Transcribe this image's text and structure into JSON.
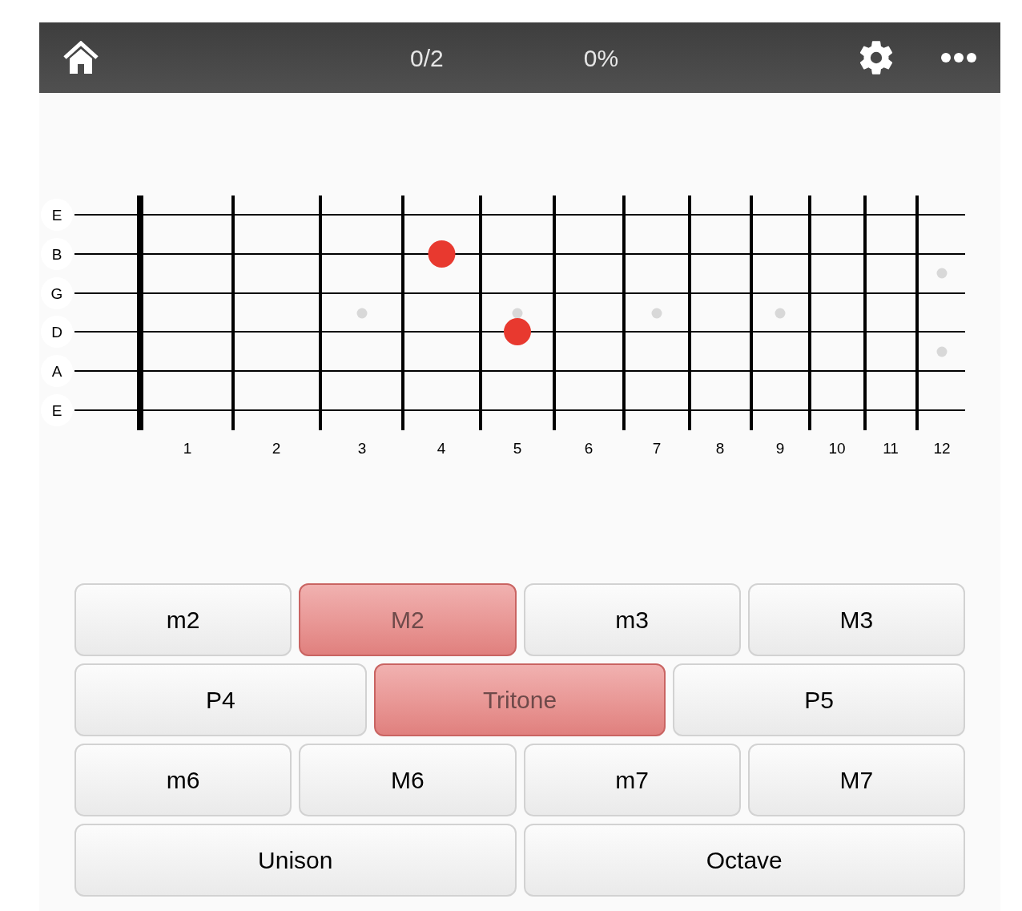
{
  "header": {
    "score": "0/2",
    "percent": "0%"
  },
  "fretboard": {
    "strings": [
      {
        "label": "E"
      },
      {
        "label": "B"
      },
      {
        "label": "G"
      },
      {
        "label": "D"
      },
      {
        "label": "A"
      },
      {
        "label": "E"
      }
    ],
    "frets": [
      {
        "label": "1",
        "pressed": [
          false,
          false,
          false,
          false,
          false,
          false
        ]
      },
      {
        "label": "2",
        "pressed": [
          false,
          false,
          false,
          false,
          false,
          false
        ]
      },
      {
        "label": "3",
        "pressed": [
          false,
          false,
          false,
          false,
          false,
          false
        ]
      },
      {
        "label": "4",
        "pressed": [
          false,
          true,
          false,
          false,
          false,
          false
        ]
      },
      {
        "label": "5",
        "pressed": [
          false,
          false,
          false,
          true,
          false,
          false
        ]
      },
      {
        "label": "6",
        "pressed": [
          false,
          false,
          false,
          false,
          false,
          false
        ]
      },
      {
        "label": "7",
        "pressed": [
          false,
          false,
          false,
          false,
          false,
          false
        ]
      },
      {
        "label": "8",
        "pressed": [
          false,
          false,
          false,
          false,
          false,
          false
        ]
      },
      {
        "label": "9",
        "pressed": [
          false,
          false,
          false,
          false,
          false,
          false
        ]
      },
      {
        "label": "10",
        "pressed": [
          false,
          false,
          false,
          false,
          false,
          false
        ]
      },
      {
        "label": "11",
        "pressed": [
          false,
          false,
          false,
          false,
          false,
          false
        ]
      },
      {
        "label": "12",
        "pressed": [
          false,
          false,
          false,
          false,
          false,
          false
        ]
      }
    ]
  },
  "answer_rows": [
    [
      {
        "label": "m2",
        "selected": false
      },
      {
        "label": "M2",
        "selected": true
      },
      {
        "label": "m3",
        "selected": false
      },
      {
        "label": "M3",
        "selected": false
      }
    ],
    [
      {
        "label": "P4",
        "selected": false
      },
      {
        "label": "Tritone",
        "selected": true
      },
      {
        "label": "P5",
        "selected": false
      }
    ],
    [
      {
        "label": "m6",
        "selected": false
      },
      {
        "label": "M6",
        "selected": false
      },
      {
        "label": "m7",
        "selected": false
      },
      {
        "label": "M7",
        "selected": false
      }
    ],
    [
      {
        "label": "Unison",
        "selected": false
      },
      {
        "label": "Octave",
        "selected": false
      }
    ]
  ]
}
